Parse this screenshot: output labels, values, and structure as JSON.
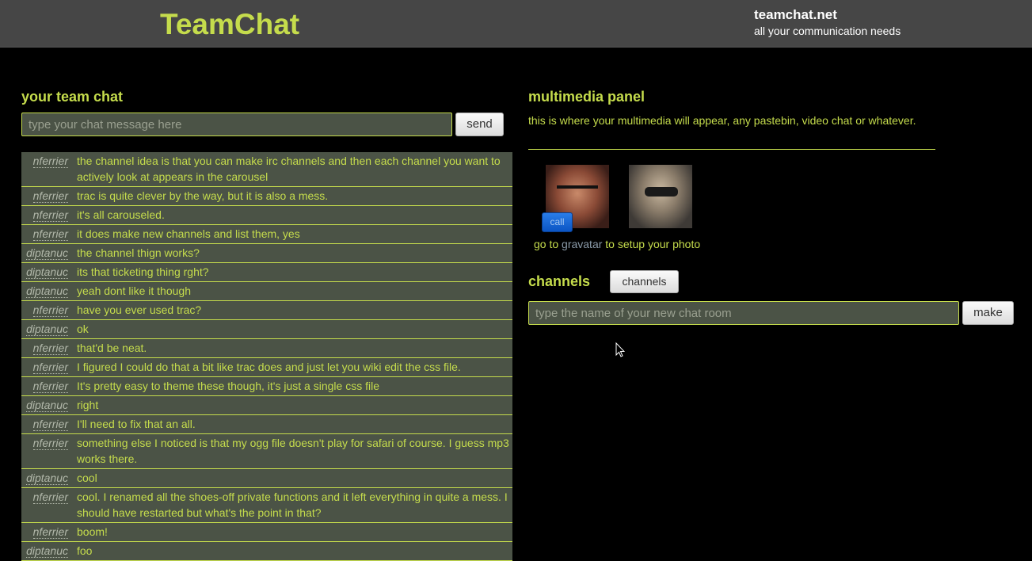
{
  "header": {
    "logo": "TeamChat",
    "site_name": "teamchat.net",
    "tagline": "all your communication needs"
  },
  "chat": {
    "title": "your team chat",
    "input_placeholder": "type your chat message here",
    "send_label": "send",
    "messages": [
      {
        "nick": "nferrier",
        "text": "the channel idea is that you can make irc channels and then each channel you want to actively look at appears in the carousel"
      },
      {
        "nick": "nferrier",
        "text": "trac is quite clever by the way, but it is also a mess."
      },
      {
        "nick": "nferrier",
        "text": "it's all carouseled."
      },
      {
        "nick": "nferrier",
        "text": "it does make new channels and list them, yes"
      },
      {
        "nick": "diptanuc",
        "text": "the channel thign works?"
      },
      {
        "nick": "diptanuc",
        "text": "its that ticketing thing rght?"
      },
      {
        "nick": "diptanuc",
        "text": "yeah dont like it though"
      },
      {
        "nick": "nferrier",
        "text": "have you ever used trac?"
      },
      {
        "nick": "diptanuc",
        "text": "ok"
      },
      {
        "nick": "nferrier",
        "text": "that'd be neat."
      },
      {
        "nick": "nferrier",
        "text": "I figured I could do that a bit like trac does and just let you wiki edit the css file."
      },
      {
        "nick": "nferrier",
        "text": "It's pretty easy to theme these though, it's just a single css file"
      },
      {
        "nick": "diptanuc",
        "text": "right"
      },
      {
        "nick": "nferrier",
        "text": "I'll need to fix that an all."
      },
      {
        "nick": "nferrier",
        "text": "something else I noticed is that my ogg file doesn't play for safari of course. I guess mp3 works there."
      },
      {
        "nick": "diptanuc",
        "text": "cool"
      },
      {
        "nick": "nferrier",
        "text": "cool. I renamed all the shoes-off private functions and it left everything in quite a mess. I should have restarted but what's the point in that?"
      },
      {
        "nick": "nferrier",
        "text": "boom!"
      },
      {
        "nick": "diptanuc",
        "text": "foo"
      }
    ]
  },
  "multimedia": {
    "title": "multimedia panel",
    "description": "this is where your multimedia will appear, any pastebin, video chat or whatever.",
    "call_label": "call",
    "gravatar_prefix": "go to",
    "gravatar_link": "gravatar",
    "gravatar_suffix": "to setup your photo"
  },
  "channels": {
    "title": "channels",
    "button_label": "channels",
    "input_placeholder": "type the name of your new chat room",
    "make_label": "make"
  },
  "colors": {
    "accent": "#c5dc4c",
    "panel": "#4b5346",
    "header": "#464646",
    "background": "#000000"
  }
}
